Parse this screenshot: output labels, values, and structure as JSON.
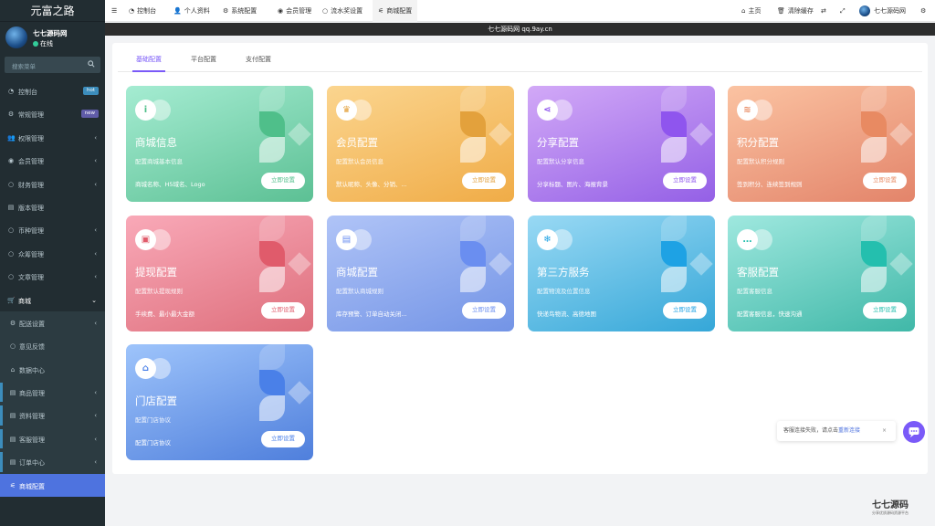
{
  "sidebar": {
    "logo": "元富之路",
    "user": {
      "name": "七七源码网",
      "status": "在线"
    },
    "search_placeholder": "搜索菜单",
    "items": [
      {
        "label": "控制台",
        "icon": "dashboard-icon",
        "badge": "hot",
        "badge_color": "#3c8dbc"
      },
      {
        "label": "常规管理",
        "icon": "gear-icon",
        "badge": "new",
        "badge_color": "#605ca8"
      },
      {
        "label": "权限管理",
        "icon": "group-icon",
        "arrow": "‹"
      },
      {
        "label": "会员管理",
        "icon": "user-circle-icon",
        "arrow": "‹"
      },
      {
        "label": "财务管理",
        "icon": "circle-icon",
        "arrow": "‹"
      },
      {
        "label": "版本管理",
        "icon": "list-icon"
      },
      {
        "label": "币种管理",
        "icon": "circle-icon",
        "arrow": "‹"
      },
      {
        "label": "众筹管理",
        "icon": "circle-icon",
        "arrow": "‹"
      },
      {
        "label": "文章管理",
        "icon": "circle-icon",
        "arrow": "‹"
      },
      {
        "label": "商城",
        "icon": "cart-icon",
        "arrow": "⌄",
        "open": true
      }
    ],
    "sub_items": [
      {
        "label": "配送设置",
        "icon": "gears-icon",
        "arrow": "‹"
      },
      {
        "label": "意见反馈",
        "icon": "circle-icon"
      },
      {
        "label": "数据中心",
        "icon": "bank-icon"
      },
      {
        "label": "商品管理",
        "icon": "list-icon",
        "arrow": "‹",
        "bar": true
      },
      {
        "label": "资料管理",
        "icon": "list-icon",
        "arrow": "‹",
        "bar": true
      },
      {
        "label": "客服管理",
        "icon": "list-icon",
        "arrow": "‹",
        "bar": true
      },
      {
        "label": "订单中心",
        "icon": "list-icon",
        "arrow": "‹",
        "bar": true
      },
      {
        "label": "商城配置",
        "icon": "sliders-icon",
        "active": true
      }
    ]
  },
  "topnav": {
    "tabs": [
      {
        "label": "控制台",
        "icon": "dashboard-icon"
      },
      {
        "label": "个人资料",
        "icon": "user-icon"
      },
      {
        "label": "系统配置",
        "icon": "gear-icon"
      },
      {
        "label": "会员管理",
        "icon": "user-circle-icon"
      },
      {
        "label": "流水奖设置",
        "icon": "circle-icon"
      },
      {
        "label": "商城配置",
        "icon": "sliders-icon",
        "active": true
      }
    ],
    "home": "主页",
    "clear_cache": "清除缓存",
    "username": "七七源码网"
  },
  "banner": "七七源码网 qq.9ay.cn",
  "config_tabs": [
    "基础配置",
    "平台配置",
    "支付配置"
  ],
  "cards": [
    {
      "title": "商城信息",
      "subtitle": "配置商城基本信息",
      "desc": "商城名称、H5域名、Logo",
      "button": "立即设置",
      "icon": "info-icon",
      "glyph": "i",
      "gradient": [
        "#a5ecd2",
        "#5cc094"
      ],
      "accent": "#4fbf8a"
    },
    {
      "title": "会员配置",
      "subtitle": "配置默认会员信息",
      "desc": "默认昵称、头像、分销、...",
      "button": "立即设置",
      "icon": "crown-icon",
      "glyph": "♛",
      "gradient": [
        "#fbd58f",
        "#f0ac47"
      ],
      "accent": "#e3a13c"
    },
    {
      "title": "分享配置",
      "subtitle": "配置默认分享信息",
      "desc": "分享标题、图片、海报背景",
      "button": "立即设置",
      "icon": "share-icon",
      "glyph": "⋖",
      "gradient": [
        "#d2a9f7",
        "#9460e6"
      ],
      "accent": "#8f55ee"
    },
    {
      "title": "积分配置",
      "subtitle": "配置默认积分规则",
      "desc": "签到积分、连续签到规则",
      "button": "立即设置",
      "icon": "coin-icon",
      "glyph": "≋",
      "gradient": [
        "#fbc3a2",
        "#e3846a"
      ],
      "accent": "#e88a62"
    },
    {
      "title": "提现配置",
      "subtitle": "配置默认提现规则",
      "desc": "手续费、最小最大金额",
      "button": "立即设置",
      "icon": "wallet-icon",
      "glyph": "▣",
      "gradient": [
        "#f9a9b8",
        "#de6f7c"
      ],
      "accent": "#e05b6b"
    },
    {
      "title": "商城配置",
      "subtitle": "配置默认商城规则",
      "desc": "库存预警、订单自动关闭...",
      "button": "立即设置",
      "icon": "store-icon",
      "glyph": "▤",
      "gradient": [
        "#b0c4f7",
        "#7394e6"
      ],
      "accent": "#6a8ef0"
    },
    {
      "title": "第三方服务",
      "subtitle": "配置物流及位置信息",
      "desc": "快递鸟物流、高德地图",
      "button": "立即设置",
      "icon": "snowflake-icon",
      "glyph": "❄",
      "gradient": [
        "#99d9f4",
        "#35a7d8"
      ],
      "accent": "#1ea2e4"
    },
    {
      "title": "客服配置",
      "subtitle": "配置客服信息",
      "desc": "配置客服信息，快速沟通",
      "button": "立即设置",
      "icon": "chat-icon",
      "glyph": "…",
      "gradient": [
        "#9fe8df",
        "#40b8a8"
      ],
      "accent": "#24bfae"
    },
    {
      "title": "门店配置",
      "subtitle": "配置门店协议",
      "desc": "配置门店协议",
      "button": "立即设置",
      "icon": "shop-icon",
      "glyph": "⌂",
      "gradient": [
        "#9ec4fb",
        "#4f7fdc"
      ],
      "accent": "#4a80e8"
    }
  ],
  "chat": {
    "text": "客服连接失败，请点击",
    "link": "重新连接",
    "close": "×"
  },
  "watermark": {
    "name": "七七源码",
    "tagline": "分享优质源码资源平台"
  }
}
